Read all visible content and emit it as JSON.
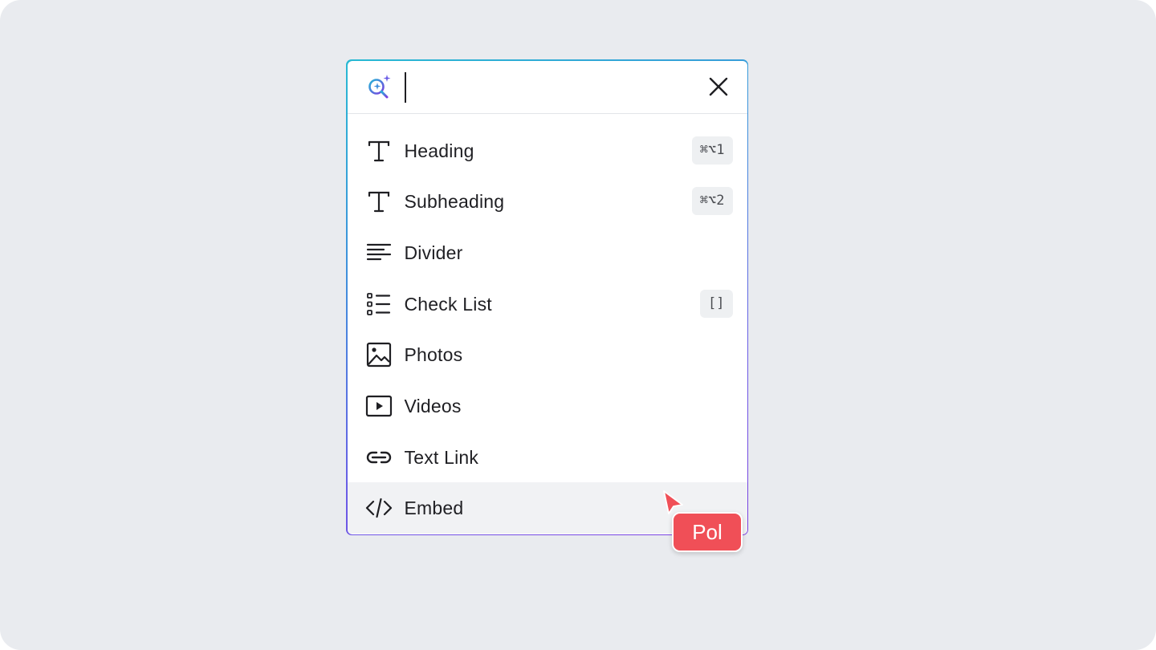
{
  "search": {
    "value": "",
    "placeholder": ""
  },
  "menu": {
    "items": [
      {
        "label": "Heading",
        "icon": "heading-icon",
        "shortcut": "⌘⌥1"
      },
      {
        "label": "Subheading",
        "icon": "subheading-icon",
        "shortcut": "⌘⌥2"
      },
      {
        "label": "Divider",
        "icon": "divider-icon",
        "shortcut": ""
      },
      {
        "label": "Check List",
        "icon": "checklist-icon",
        "shortcut": "[]"
      },
      {
        "label": "Photos",
        "icon": "photo-icon",
        "shortcut": ""
      },
      {
        "label": "Videos",
        "icon": "video-icon",
        "shortcut": ""
      },
      {
        "label": "Text Link",
        "icon": "link-icon",
        "shortcut": ""
      },
      {
        "label": "Embed",
        "icon": "code-icon",
        "shortcut": ""
      }
    ],
    "hovered_item": "Embed"
  },
  "collaborator": {
    "name": "Pol",
    "color": "#f04f57"
  },
  "colors": {
    "background": "#e9ebef",
    "border_gradient": [
      "#27b9d3",
      "#7b3fe0"
    ],
    "hover_row": "#f1f2f4",
    "text": "#1f1f23"
  }
}
